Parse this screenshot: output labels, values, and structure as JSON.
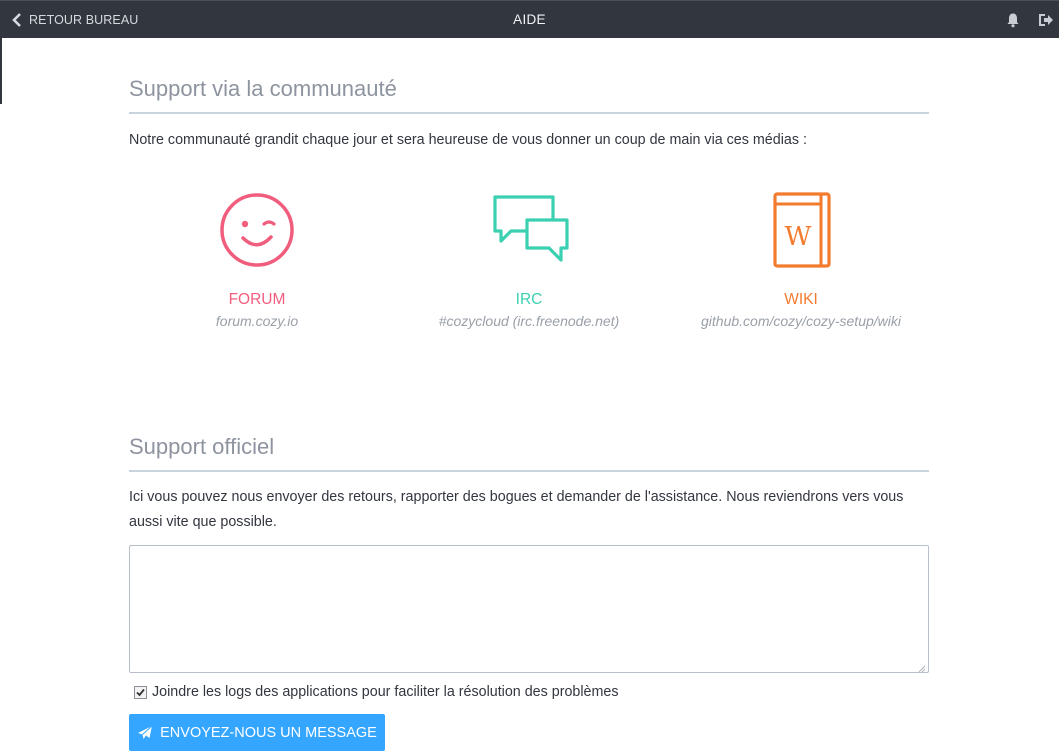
{
  "header": {
    "back_label": "RETOUR BUREAU",
    "title": "AIDE"
  },
  "community": {
    "title": "Support via la communauté",
    "description": "Notre communauté grandit chaque jour et sera heureuse de vous donner un coup de main via ces médias :",
    "media": [
      {
        "name": "FORUM",
        "address": "forum.cozy.io",
        "icon": "smiley-wink-icon",
        "color": "#f05d7d"
      },
      {
        "name": "IRC",
        "address": "#cozycloud (irc.freenode.net)",
        "icon": "chat-bubbles-icon",
        "color": "#3ad0b1"
      },
      {
        "name": "WIKI",
        "address": "github.com/cozy/cozy-setup/wiki",
        "icon": "wiki-book-icon",
        "color": "#f37b2d"
      }
    ]
  },
  "official": {
    "title": "Support officiel",
    "description": "Ici vous pouvez nous envoyer des retours, rapporter des bogues et demander de l'assistance. Nous reviendrons vers vous aussi vite que possible.",
    "message_value": "",
    "attach_logs_label": "Joindre les logs des applications pour faciliter la résolution des problèmes",
    "attach_logs_checked": true,
    "send_label": "ENVOYEZ-NOUS UN MESSAGE"
  },
  "colors": {
    "topbar": "#32363f",
    "accent": "#34a6ff",
    "section_title": "#8e949f"
  }
}
